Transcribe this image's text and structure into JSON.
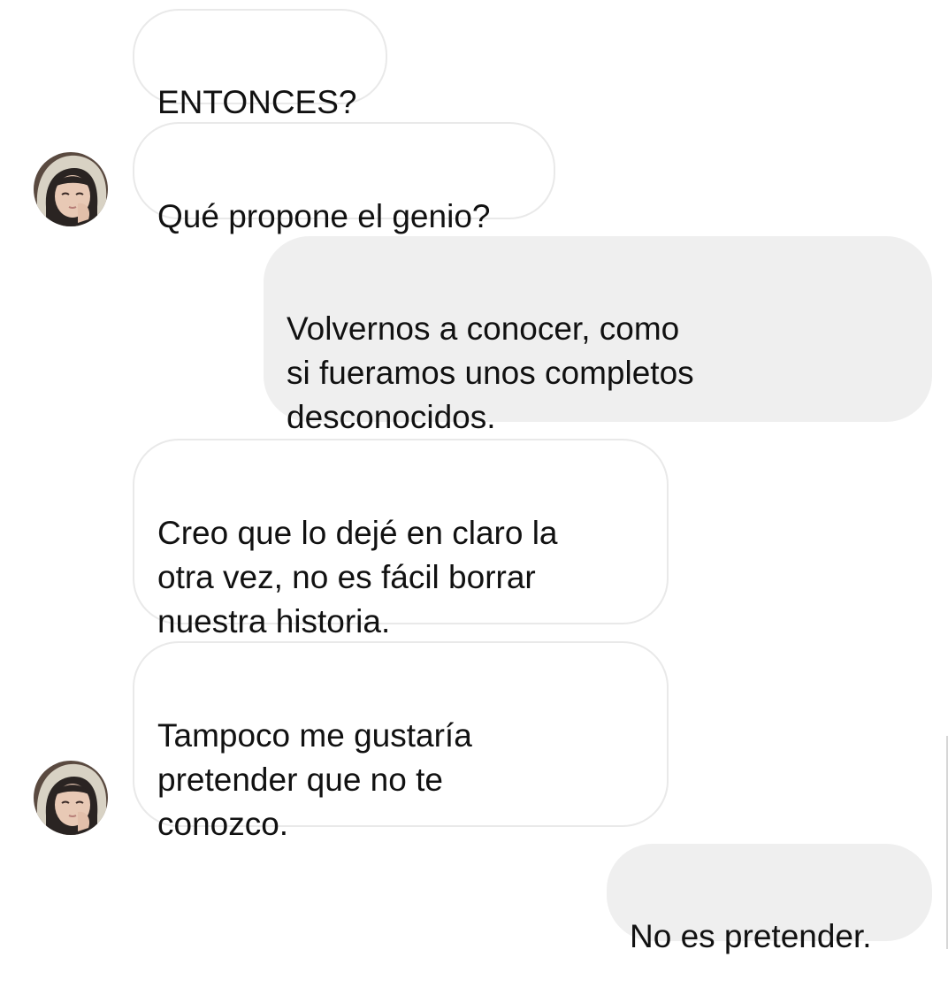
{
  "thread": {
    "messages": [
      {
        "side": "in",
        "text": "ENTONCES?"
      },
      {
        "side": "in",
        "text": "Qué propone el genio?"
      },
      {
        "side": "out",
        "text": "Volvernos a conocer, como\nsi fueramos unos completos\ndesconocidos."
      },
      {
        "side": "in",
        "text": "Creo que lo dejé en claro la\notra vez, no es fácil borrar\nnuestra historia."
      },
      {
        "side": "in",
        "text": "Tampoco me gustaría\npretender que no te\nconozco."
      },
      {
        "side": "out",
        "text": "No es pretender."
      }
    ]
  },
  "avatar": {
    "icon": "contact-avatar-icon",
    "colors": {
      "hood": "#d8d2c4",
      "hair": "#2a2422",
      "skin": "#e8c9b5",
      "background": "#5a4a40"
    }
  },
  "colors": {
    "incoming_bubble_bg": "#ffffff",
    "incoming_bubble_border": "#e9e9e9",
    "outgoing_bubble_bg": "#efefef",
    "text": "#111111"
  }
}
